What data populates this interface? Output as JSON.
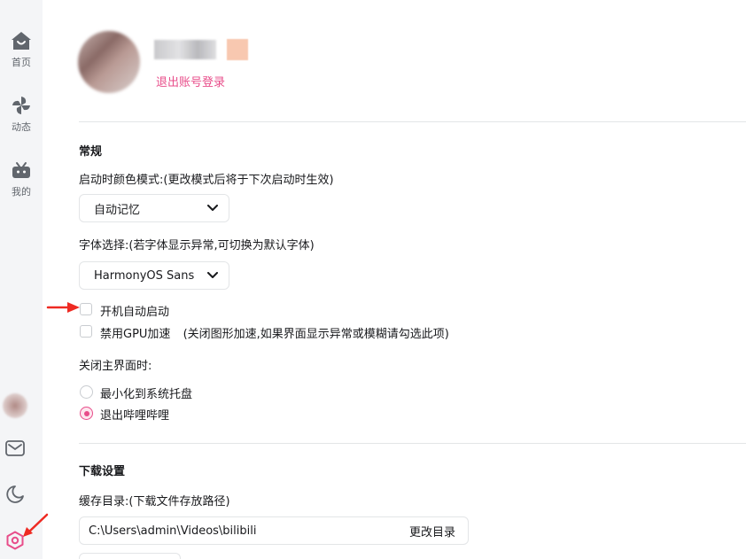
{
  "sidebar": {
    "nav": [
      {
        "label": "首页",
        "icon": "home-icon"
      },
      {
        "label": "动态",
        "icon": "pinwheel-icon"
      },
      {
        "label": "我的",
        "icon": "tv-icon"
      }
    ],
    "bottom_icons": [
      "avatar",
      "mail-icon",
      "moon-icon",
      "settings-icon"
    ],
    "accent": "#e84d8a"
  },
  "account": {
    "logout_label": "退出账号登录"
  },
  "general": {
    "title": "常规",
    "color_mode_label": "启动时颜色模式:(更改模式后将于下次启动时生效)",
    "color_mode_value": "自动记忆",
    "font_label": "字体选择:(若字体显示异常,可切换为默认字体)",
    "font_value": "HarmonyOS Sans",
    "autostart_label": "开机自动启动",
    "autostart_checked": false,
    "gpu_label": "禁用GPU加速",
    "gpu_hint": "(关闭图形加速,如果界面显示异常或模糊请勾选此项)",
    "gpu_checked": false,
    "close_label": "关闭主界面时:",
    "close_options": [
      {
        "label": "最小化到系统托盘",
        "checked": false
      },
      {
        "label": "退出哔哩哔哩",
        "checked": true
      }
    ]
  },
  "download": {
    "title": "下载设置",
    "cache_label": "缓存目录:(下载文件存放路径)",
    "cache_path": "C:\\Users\\admin\\Videos\\bilibili",
    "change_dir_label": "更改目录"
  }
}
